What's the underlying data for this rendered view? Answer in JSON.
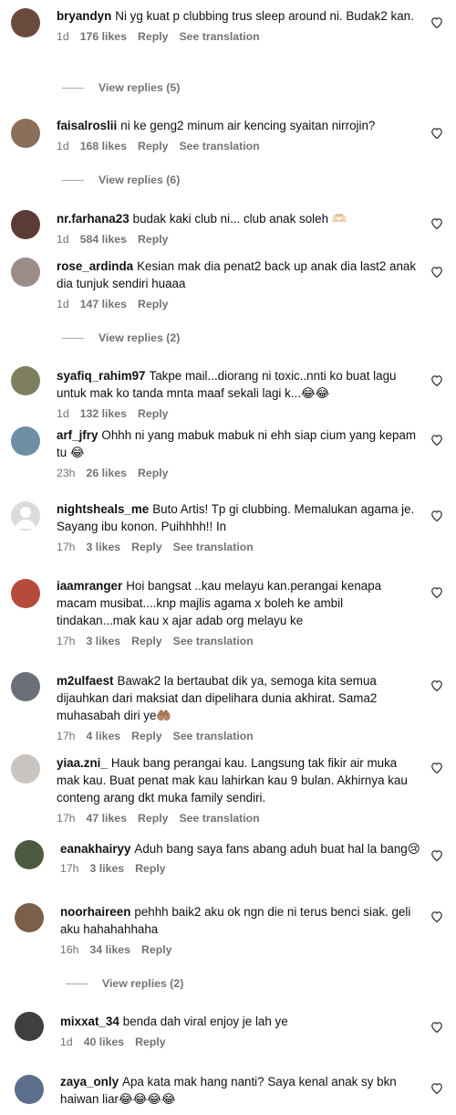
{
  "comments": [
    {
      "user": "bryandyn",
      "text": "Ni yg kuat p clubbing trus sleep around ni. Budak2 kan.",
      "time": "1d",
      "likes": "176 likes",
      "reply": "Reply",
      "translate": "See translation",
      "view_replies": "View replies (5)",
      "avatar_color": "#6b4a3e"
    },
    {
      "user": "faisalroslii",
      "text": "ni ke geng2 minum air kencing syaitan nirrojin?",
      "time": "1d",
      "likes": "168 likes",
      "reply": "Reply",
      "translate": "See translation",
      "view_replies": "View replies (6)",
      "avatar_color": "#8a6f5a"
    },
    {
      "user": "nr.farhana23",
      "text": "budak kaki club ni... club anak soleh 🫶🏻",
      "time": "1d",
      "likes": "584 likes",
      "reply": "Reply",
      "translate": "",
      "view_replies": "",
      "avatar_color": "#5c3b34"
    },
    {
      "user": "rose_ardinda",
      "text": "Kesian mak dia penat2 back up anak dia last2 anak dia tunjuk sendiri huaaa",
      "time": "1d",
      "likes": "147 likes",
      "reply": "Reply",
      "translate": "",
      "view_replies": "View replies (2)",
      "avatar_color": "#9c8b86"
    },
    {
      "user": "syafiq_rahim97",
      "text": "Takpe mail...diorang ni toxic..nnti ko buat lagu untuk mak ko tanda mnta maaf sekali lagi k...😂😂",
      "time": "1d",
      "likes": "132 likes",
      "reply": "Reply",
      "translate": "",
      "view_replies": "",
      "avatar_color": "#7d7f5e"
    },
    {
      "user": "arf_jfry",
      "text": "Ohhh ni yang mabuk mabuk ni ehh siap cium yang kepam tu 😂",
      "time": "23h",
      "likes": "26 likes",
      "reply": "Reply",
      "translate": "",
      "view_replies": "",
      "avatar_color": "#6d8ea3"
    },
    {
      "user": "nightsheals_me",
      "text": "Buto Artis! Tp gi clubbing. Memalukan agama je. Sayang ibu konon. Puihhhh!! In",
      "time": "17h",
      "likes": "3 likes",
      "reply": "Reply",
      "translate": "See translation",
      "view_replies": "",
      "avatar_color": "#dbdbdb"
    },
    {
      "user": "iaamranger",
      "text": "Hoi bangsat ..kau melayu kan.perangai kenapa macam musibat....knp majlis agama x boleh ke ambil tindakan...mak kau x ajar adab org melayu ke",
      "time": "17h",
      "likes": "3 likes",
      "reply": "Reply",
      "translate": "See translation",
      "view_replies": "",
      "avatar_color": "#b54a3d"
    },
    {
      "user": "m2ulfaest",
      "text": "Bawak2 la bertaubat dik ya, semoga kita semua dijauhkan dari maksiat dan dipelihara dunia akhirat. Sama2 muhasabah diri ye🤲🏽",
      "time": "17h",
      "likes": "4 likes",
      "reply": "Reply",
      "translate": "See translation",
      "view_replies": "",
      "avatar_color": "#6a6f78"
    },
    {
      "user": "yiaa.zni_",
      "text": "Hauk bang perangai kau. Langsung tak fikir air muka mak kau. Buat penat mak kau lahirkan kau 9 bulan. Akhirnya kau conteng arang dkt muka family sendiri.",
      "time": "17h",
      "likes": "47 likes",
      "reply": "Reply",
      "translate": "See translation",
      "view_replies": "",
      "avatar_color": "#c9c4c0"
    },
    {
      "user": "eanakhairyy",
      "text": "Aduh bang saya fans abang aduh buat hal la bang😢",
      "time": "17h",
      "likes": "3 likes",
      "reply": "Reply",
      "translate": "",
      "view_replies": "",
      "avatar_color": "#4e5a3f"
    },
    {
      "user": "noorhaireen",
      "text": "pehhh baik2 aku ok ngn die ni terus benci siak. geli aku hahahahhaha",
      "time": "16h",
      "likes": "34 likes",
      "reply": "Reply",
      "translate": "",
      "view_replies": "View replies (2)",
      "avatar_color": "#7a5f4a"
    },
    {
      "user": "mixxat_34",
      "text": "benda dah viral enjoy je lah ye",
      "time": "1d",
      "likes": "40 likes",
      "reply": "Reply",
      "translate": "",
      "view_replies": "",
      "avatar_color": "#3f3f3f"
    },
    {
      "user": "zaya_only",
      "text": "Apa kata mak hang nanti? Saya kenal anak sy bkn haiwan liar😂😂😂😂",
      "time": "",
      "likes": "",
      "reply": "",
      "translate": "",
      "view_replies": "",
      "avatar_color": "#5b6e8c"
    }
  ]
}
